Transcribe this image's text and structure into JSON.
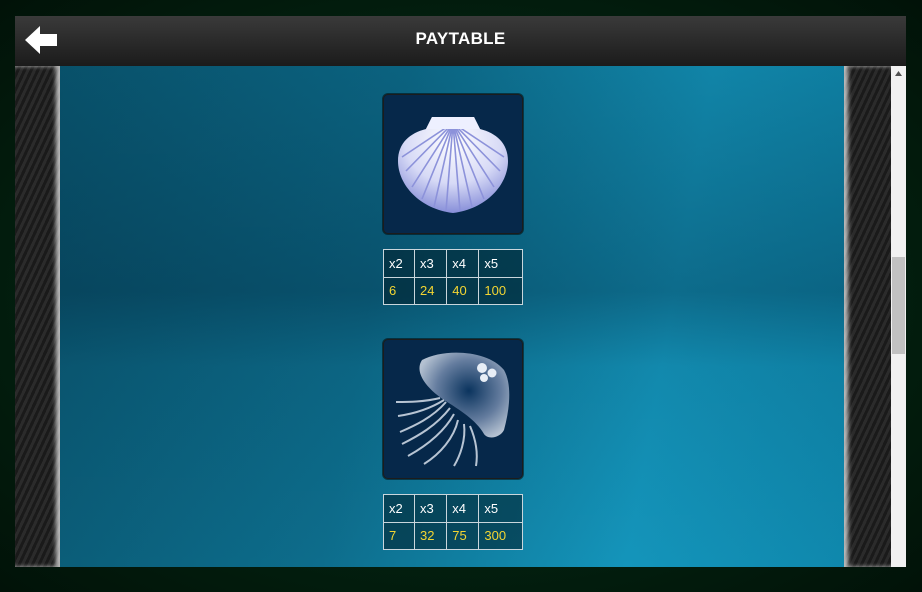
{
  "header": {
    "title": "PAYTABLE",
    "back_icon": "arrow-left-icon"
  },
  "symbols": [
    {
      "icon": "scallop-shell-icon",
      "pays": {
        "headers": [
          "x2",
          "x3",
          "x4",
          "x5"
        ],
        "values": [
          "6",
          "24",
          "40",
          "100"
        ]
      }
    },
    {
      "icon": "jellyfish-icon",
      "pays": {
        "headers": [
          "x2",
          "x3",
          "x4",
          "x5"
        ],
        "values": [
          "7",
          "32",
          "75",
          "300"
        ]
      }
    }
  ],
  "colors": {
    "header_text": "#ffffff",
    "pay_value_text": "#f3d532",
    "water": "#0d6d8c",
    "symbol_bg": "#06284a"
  },
  "scrollbar": {
    "position": 0.38
  }
}
